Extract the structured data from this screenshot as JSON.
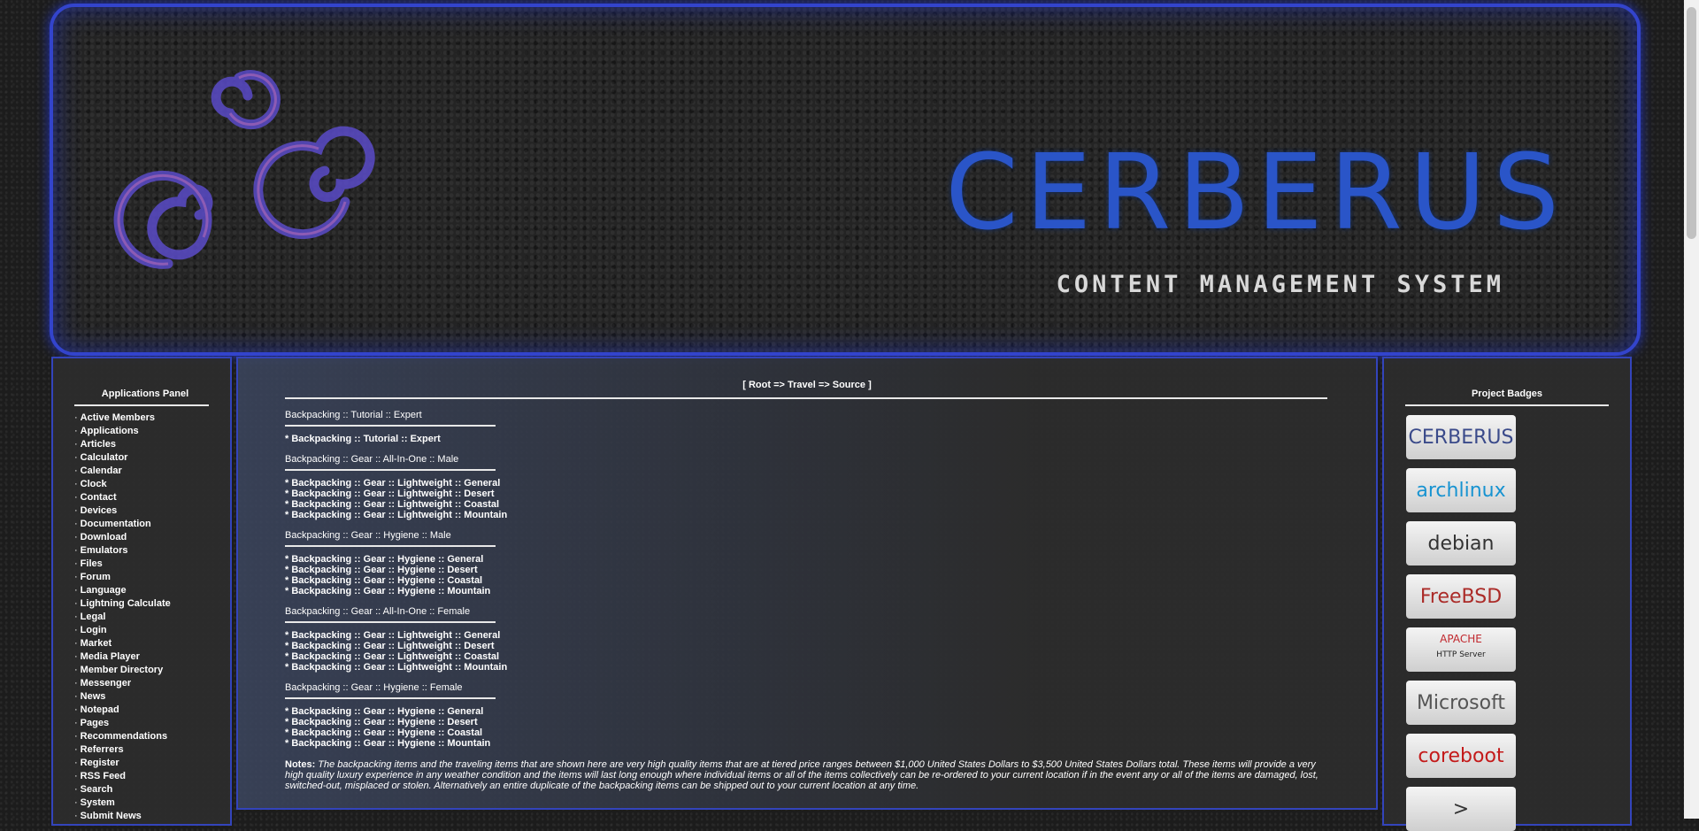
{
  "banner": {
    "title": "CERBERUS",
    "subtitle": "CONTENT MANAGEMENT SYSTEM",
    "logo_icon": "triple-swirl-icon"
  },
  "applications_panel": {
    "heading": "Applications Panel",
    "bullet": "·",
    "items": [
      "Active Members",
      "Applications",
      "Articles",
      "Calculator",
      "Calendar",
      "Clock",
      "Contact",
      "Devices",
      "Documentation",
      "Download",
      "Emulators",
      "Files",
      "Forum",
      "Language",
      "Lightning Calculate",
      "Legal",
      "Login",
      "Market",
      "Media Player",
      "Member Directory",
      "Messenger",
      "News",
      "Notepad",
      "Pages",
      "Recommendations",
      "Referrers",
      "Register",
      "RSS Feed",
      "Search",
      "System",
      "Submit News"
    ]
  },
  "main": {
    "breadcrumb": "[ Root => Travel => Source ]",
    "sections": [
      {
        "title": "Backpacking :: Tutorial :: Expert",
        "items": [
          "* Backpacking :: Tutorial :: Expert"
        ]
      },
      {
        "title": "Backpacking :: Gear :: All-In-One :: Male",
        "items": [
          "* Backpacking :: Gear :: Lightweight :: General",
          "* Backpacking :: Gear :: Lightweight :: Desert",
          "* Backpacking :: Gear :: Lightweight :: Coastal",
          "* Backpacking :: Gear :: Lightweight :: Mountain"
        ]
      },
      {
        "title": "Backpacking :: Gear :: Hygiene :: Male",
        "items": [
          "* Backpacking :: Gear :: Hygiene :: General",
          "* Backpacking :: Gear :: Hygiene :: Desert",
          "* Backpacking :: Gear :: Hygiene :: Coastal",
          "* Backpacking :: Gear :: Hygiene :: Mountain"
        ]
      },
      {
        "title": "Backpacking :: Gear :: All-In-One :: Female",
        "items": [
          "* Backpacking :: Gear :: Lightweight :: General",
          "* Backpacking :: Gear :: Lightweight :: Desert",
          "* Backpacking :: Gear :: Lightweight :: Coastal",
          "* Backpacking :: Gear :: Lightweight :: Mountain"
        ]
      },
      {
        "title": "Backpacking :: Gear :: Hygiene :: Female",
        "items": [
          "* Backpacking :: Gear :: Hygiene :: General",
          "* Backpacking :: Gear :: Hygiene :: Desert",
          "* Backpacking :: Gear :: Hygiene :: Coastal",
          "* Backpacking :: Gear :: Hygiene :: Mountain"
        ]
      }
    ],
    "notes_label": "Notes",
    "notes_text": "The backpacking items and the traveling items that are shown here are very high quality items that are at tiered price ranges between $1,000 United States Dollars to $3,500 United States Dollars total. These items will provide a very high quality luxury experience in any weather condition and the items will last long enough where individual items or all of the items collectively can be re-ordered to your current location if in the event any or all of the items are damaged, lost, switched-out, misplaced or stolen. Alternatively an entire duplicate of the backpacking items can be shipped out to your current location at any time."
  },
  "badges_panel": {
    "heading": "Project Badges",
    "badges": [
      {
        "name": "cerberus",
        "label": "CERBERUS",
        "color": "#3a4a8a"
      },
      {
        "name": "archlinux",
        "label": "archlinux",
        "color": "#1793d1"
      },
      {
        "name": "debian",
        "label": "debian",
        "color": "#333333"
      },
      {
        "name": "freebsd",
        "label": "FreeBSD",
        "color": "#ab2b28"
      },
      {
        "name": "apache",
        "label": "APACHE",
        "sub": "HTTP Server",
        "color": "#c1272d"
      },
      {
        "name": "microsoft",
        "label": "Microsoft",
        "color": "#555555"
      },
      {
        "name": "coreboot",
        "label": "coreboot",
        "color": "#c41a1a"
      },
      {
        "name": "terminal",
        "label": ">",
        "color": "#333333"
      }
    ]
  },
  "colors": {
    "accent_border": "#3344bb",
    "banner_title": "#2a55c8"
  }
}
